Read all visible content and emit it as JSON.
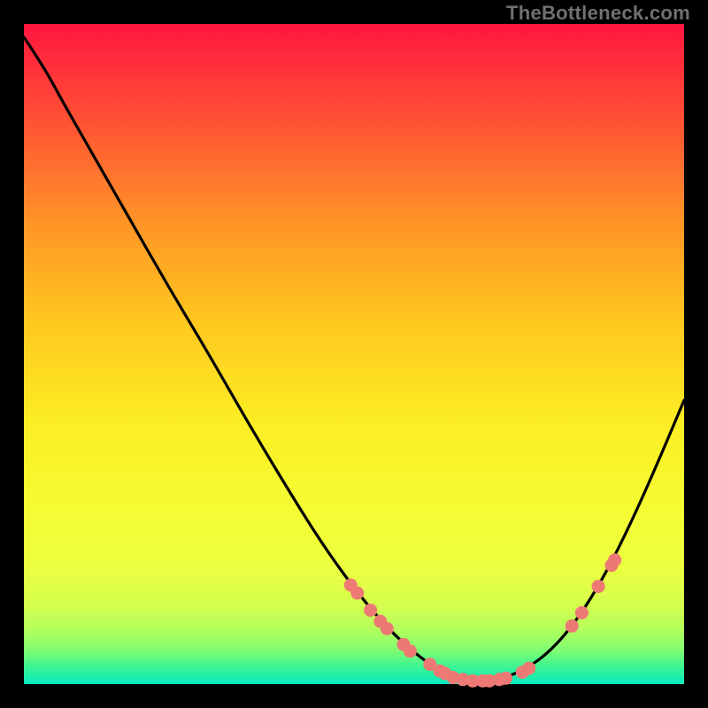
{
  "watermark": "TheBottleneck.com",
  "colors": {
    "gradient_top": "#ff163f",
    "gradient_bottom": "#0aebc3",
    "curve_stroke": "#000000",
    "marker_fill": "#ed7974",
    "background": "#000000"
  },
  "chart_data": {
    "type": "line",
    "title": "",
    "xlabel": "",
    "ylabel": "",
    "xlim": [
      0,
      100
    ],
    "ylim": [
      0,
      100
    ],
    "note": "Axes unlabeled; x and y values estimated as percent of plot width/height. y expressed as percent from top (0 at top, 100 at bottom). Marker points estimated from visible dots along the curve.",
    "curve_points": [
      {
        "x": 0.0,
        "y": 2.0
      },
      {
        "x": 3.0,
        "y": 6.5
      },
      {
        "x": 6.0,
        "y": 12.0
      },
      {
        "x": 10.0,
        "y": 19.0
      },
      {
        "x": 16.0,
        "y": 29.5
      },
      {
        "x": 22.0,
        "y": 40.0
      },
      {
        "x": 28.0,
        "y": 50.0
      },
      {
        "x": 34.0,
        "y": 60.5
      },
      {
        "x": 40.0,
        "y": 70.5
      },
      {
        "x": 45.0,
        "y": 78.5
      },
      {
        "x": 50.0,
        "y": 85.5
      },
      {
        "x": 55.0,
        "y": 91.5
      },
      {
        "x": 60.0,
        "y": 96.0
      },
      {
        "x": 64.0,
        "y": 98.5
      },
      {
        "x": 68.0,
        "y": 99.5
      },
      {
        "x": 72.0,
        "y": 99.3
      },
      {
        "x": 76.0,
        "y": 97.8
      },
      {
        "x": 80.0,
        "y": 94.8
      },
      {
        "x": 84.0,
        "y": 90.0
      },
      {
        "x": 88.0,
        "y": 83.5
      },
      {
        "x": 92.0,
        "y": 75.5
      },
      {
        "x": 96.0,
        "y": 66.5
      },
      {
        "x": 100.0,
        "y": 57.0
      }
    ],
    "markers": [
      {
        "x": 49.5,
        "y": 85.0
      },
      {
        "x": 50.5,
        "y": 86.2
      },
      {
        "x": 52.5,
        "y": 88.8
      },
      {
        "x": 54.0,
        "y": 90.5
      },
      {
        "x": 55.0,
        "y": 91.6
      },
      {
        "x": 57.5,
        "y": 94.0
      },
      {
        "x": 58.5,
        "y": 95.0
      },
      {
        "x": 61.5,
        "y": 97.0
      },
      {
        "x": 63.0,
        "y": 98.0
      },
      {
        "x": 63.8,
        "y": 98.4
      },
      {
        "x": 65.0,
        "y": 99.0
      },
      {
        "x": 66.5,
        "y": 99.3
      },
      {
        "x": 68.0,
        "y": 99.5
      },
      {
        "x": 69.5,
        "y": 99.5
      },
      {
        "x": 70.5,
        "y": 99.5
      },
      {
        "x": 72.0,
        "y": 99.3
      },
      {
        "x": 73.0,
        "y": 99.1
      },
      {
        "x": 75.5,
        "y": 98.2
      },
      {
        "x": 76.5,
        "y": 97.6
      },
      {
        "x": 83.0,
        "y": 91.2
      },
      {
        "x": 84.5,
        "y": 89.2
      },
      {
        "x": 87.0,
        "y": 85.2
      },
      {
        "x": 89.0,
        "y": 82.0
      },
      {
        "x": 89.5,
        "y": 81.2
      }
    ]
  }
}
